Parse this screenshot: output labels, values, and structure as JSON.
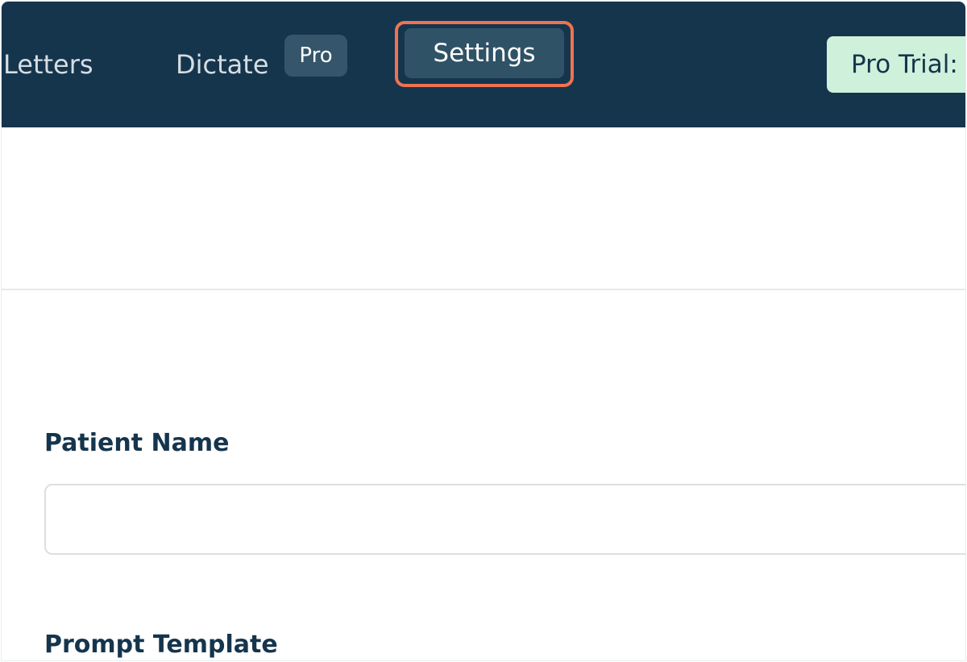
{
  "navbar": {
    "items": [
      {
        "label": "Letters"
      },
      {
        "label": "Dictate",
        "badge": "Pro"
      },
      {
        "label": "Settings",
        "active": true
      }
    ],
    "trial_chip": "Pro Trial:"
  },
  "form": {
    "patient_name": {
      "label": "Patient Name",
      "value": "",
      "placeholder": ""
    },
    "prompt_template": {
      "label": "Prompt Template"
    }
  },
  "colors": {
    "navbar_bg": "#15354d",
    "active_tab_bg": "#2f5267",
    "badge_bg": "#34556a",
    "highlight_border": "#ef7350",
    "trial_chip_bg": "#cff0da",
    "label_text": "#15354d"
  }
}
